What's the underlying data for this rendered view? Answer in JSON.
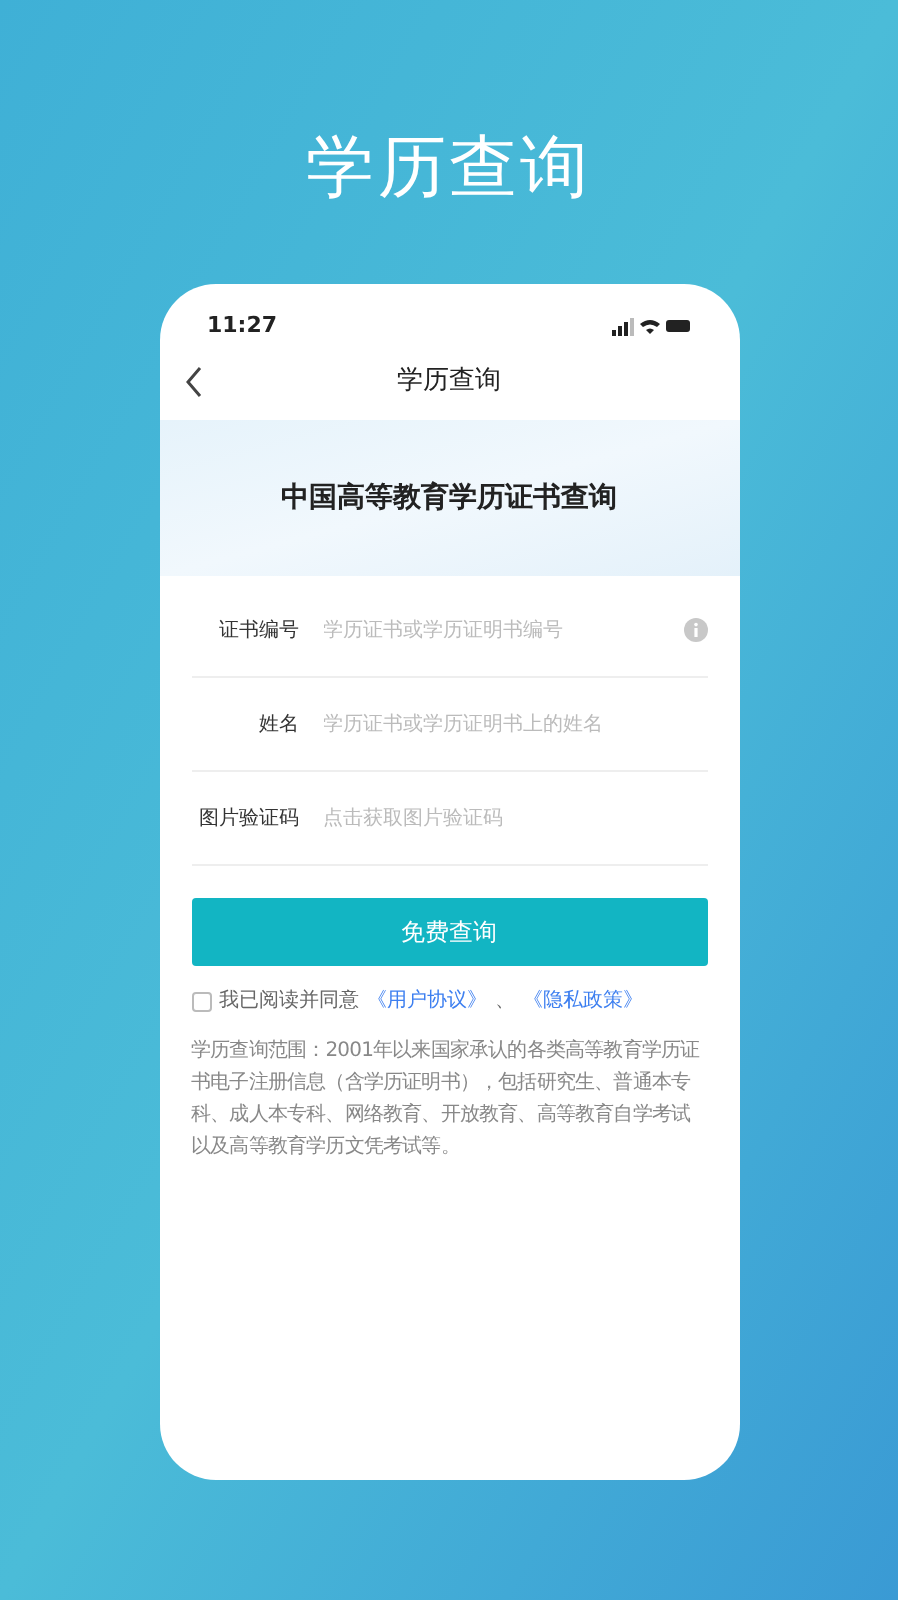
{
  "headline": "学历查询",
  "status_bar": {
    "time": "11:27"
  },
  "nav": {
    "title": "学历查询"
  },
  "banner": {
    "title": "中国高等教育学历证书查询"
  },
  "fields": [
    {
      "label": "证书编号",
      "placeholder": "学历证书或学历证明书编号",
      "info": true
    },
    {
      "label": "姓名",
      "placeholder": "学历证书或学历证明书上的姓名",
      "info": false
    },
    {
      "label": "图片验证码",
      "placeholder": "点击获取图片验证码",
      "info": false
    }
  ],
  "submit": "免费查询",
  "agreement": {
    "checked": false,
    "text": "我已阅读并同意",
    "links": [
      "《用户协议》",
      "《隐私政策》"
    ],
    "separator": "、"
  },
  "note": "学历查询范围：2001年以来国家承认的各类高等教育学历证书电子注册信息（含学历证明书），包括研究生、普通本专科、成人本专科、网络教育、开放教育、高等教育自学考试以及高等教育学历文凭考试等。"
}
